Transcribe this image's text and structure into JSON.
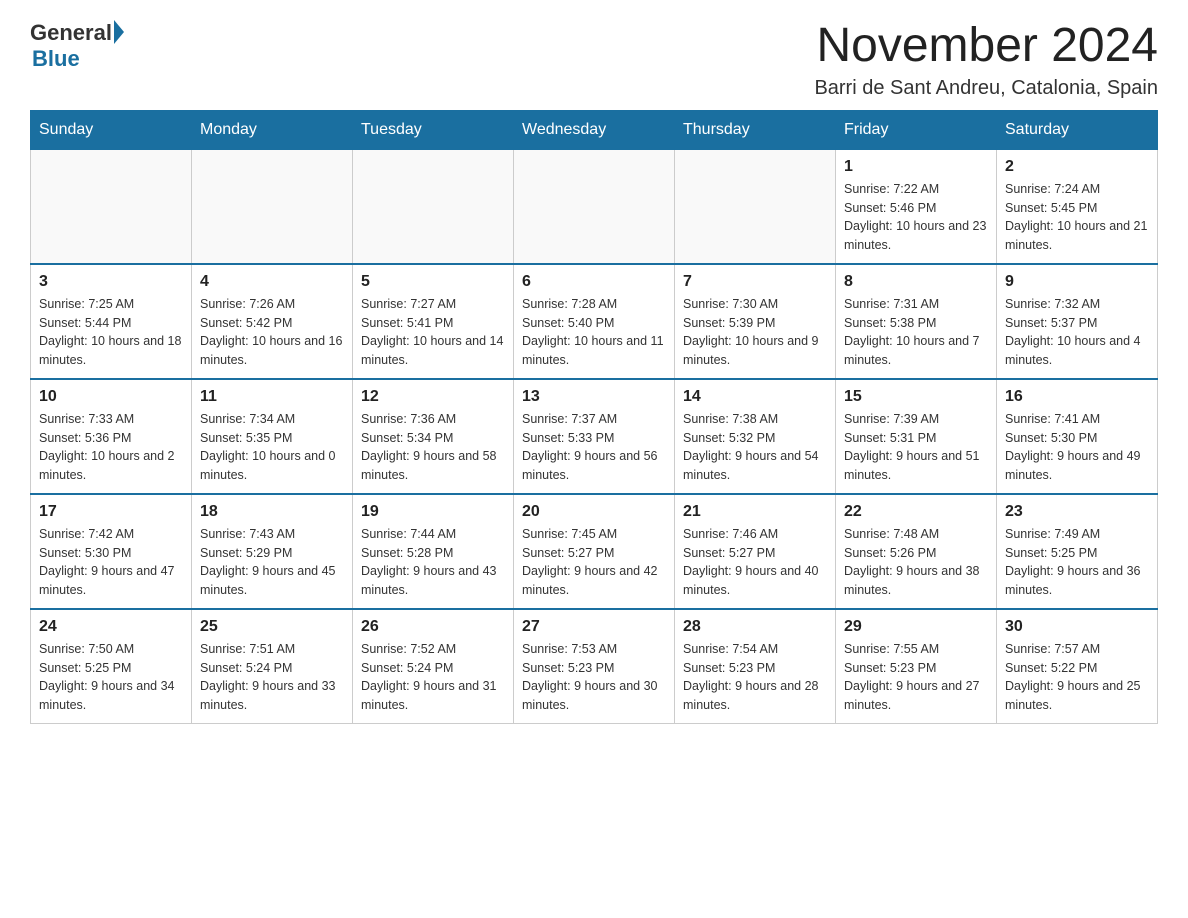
{
  "header": {
    "logo": {
      "general": "General",
      "arrow": "▶",
      "blue": "Blue"
    },
    "title": "November 2024",
    "subtitle": "Barri de Sant Andreu, Catalonia, Spain"
  },
  "weekdays": [
    "Sunday",
    "Monday",
    "Tuesday",
    "Wednesday",
    "Thursday",
    "Friday",
    "Saturday"
  ],
  "weeks": [
    [
      {
        "day": "",
        "info": ""
      },
      {
        "day": "",
        "info": ""
      },
      {
        "day": "",
        "info": ""
      },
      {
        "day": "",
        "info": ""
      },
      {
        "day": "",
        "info": ""
      },
      {
        "day": "1",
        "info": "Sunrise: 7:22 AM\nSunset: 5:46 PM\nDaylight: 10 hours and 23 minutes."
      },
      {
        "day": "2",
        "info": "Sunrise: 7:24 AM\nSunset: 5:45 PM\nDaylight: 10 hours and 21 minutes."
      }
    ],
    [
      {
        "day": "3",
        "info": "Sunrise: 7:25 AM\nSunset: 5:44 PM\nDaylight: 10 hours and 18 minutes."
      },
      {
        "day": "4",
        "info": "Sunrise: 7:26 AM\nSunset: 5:42 PM\nDaylight: 10 hours and 16 minutes."
      },
      {
        "day": "5",
        "info": "Sunrise: 7:27 AM\nSunset: 5:41 PM\nDaylight: 10 hours and 14 minutes."
      },
      {
        "day": "6",
        "info": "Sunrise: 7:28 AM\nSunset: 5:40 PM\nDaylight: 10 hours and 11 minutes."
      },
      {
        "day": "7",
        "info": "Sunrise: 7:30 AM\nSunset: 5:39 PM\nDaylight: 10 hours and 9 minutes."
      },
      {
        "day": "8",
        "info": "Sunrise: 7:31 AM\nSunset: 5:38 PM\nDaylight: 10 hours and 7 minutes."
      },
      {
        "day": "9",
        "info": "Sunrise: 7:32 AM\nSunset: 5:37 PM\nDaylight: 10 hours and 4 minutes."
      }
    ],
    [
      {
        "day": "10",
        "info": "Sunrise: 7:33 AM\nSunset: 5:36 PM\nDaylight: 10 hours and 2 minutes."
      },
      {
        "day": "11",
        "info": "Sunrise: 7:34 AM\nSunset: 5:35 PM\nDaylight: 10 hours and 0 minutes."
      },
      {
        "day": "12",
        "info": "Sunrise: 7:36 AM\nSunset: 5:34 PM\nDaylight: 9 hours and 58 minutes."
      },
      {
        "day": "13",
        "info": "Sunrise: 7:37 AM\nSunset: 5:33 PM\nDaylight: 9 hours and 56 minutes."
      },
      {
        "day": "14",
        "info": "Sunrise: 7:38 AM\nSunset: 5:32 PM\nDaylight: 9 hours and 54 minutes."
      },
      {
        "day": "15",
        "info": "Sunrise: 7:39 AM\nSunset: 5:31 PM\nDaylight: 9 hours and 51 minutes."
      },
      {
        "day": "16",
        "info": "Sunrise: 7:41 AM\nSunset: 5:30 PM\nDaylight: 9 hours and 49 minutes."
      }
    ],
    [
      {
        "day": "17",
        "info": "Sunrise: 7:42 AM\nSunset: 5:30 PM\nDaylight: 9 hours and 47 minutes."
      },
      {
        "day": "18",
        "info": "Sunrise: 7:43 AM\nSunset: 5:29 PM\nDaylight: 9 hours and 45 minutes."
      },
      {
        "day": "19",
        "info": "Sunrise: 7:44 AM\nSunset: 5:28 PM\nDaylight: 9 hours and 43 minutes."
      },
      {
        "day": "20",
        "info": "Sunrise: 7:45 AM\nSunset: 5:27 PM\nDaylight: 9 hours and 42 minutes."
      },
      {
        "day": "21",
        "info": "Sunrise: 7:46 AM\nSunset: 5:27 PM\nDaylight: 9 hours and 40 minutes."
      },
      {
        "day": "22",
        "info": "Sunrise: 7:48 AM\nSunset: 5:26 PM\nDaylight: 9 hours and 38 minutes."
      },
      {
        "day": "23",
        "info": "Sunrise: 7:49 AM\nSunset: 5:25 PM\nDaylight: 9 hours and 36 minutes."
      }
    ],
    [
      {
        "day": "24",
        "info": "Sunrise: 7:50 AM\nSunset: 5:25 PM\nDaylight: 9 hours and 34 minutes."
      },
      {
        "day": "25",
        "info": "Sunrise: 7:51 AM\nSunset: 5:24 PM\nDaylight: 9 hours and 33 minutes."
      },
      {
        "day": "26",
        "info": "Sunrise: 7:52 AM\nSunset: 5:24 PM\nDaylight: 9 hours and 31 minutes."
      },
      {
        "day": "27",
        "info": "Sunrise: 7:53 AM\nSunset: 5:23 PM\nDaylight: 9 hours and 30 minutes."
      },
      {
        "day": "28",
        "info": "Sunrise: 7:54 AM\nSunset: 5:23 PM\nDaylight: 9 hours and 28 minutes."
      },
      {
        "day": "29",
        "info": "Sunrise: 7:55 AM\nSunset: 5:23 PM\nDaylight: 9 hours and 27 minutes."
      },
      {
        "day": "30",
        "info": "Sunrise: 7:57 AM\nSunset: 5:22 PM\nDaylight: 9 hours and 25 minutes."
      }
    ]
  ],
  "colors": {
    "header_bg": "#1a6fa0",
    "border": "#cccccc"
  }
}
